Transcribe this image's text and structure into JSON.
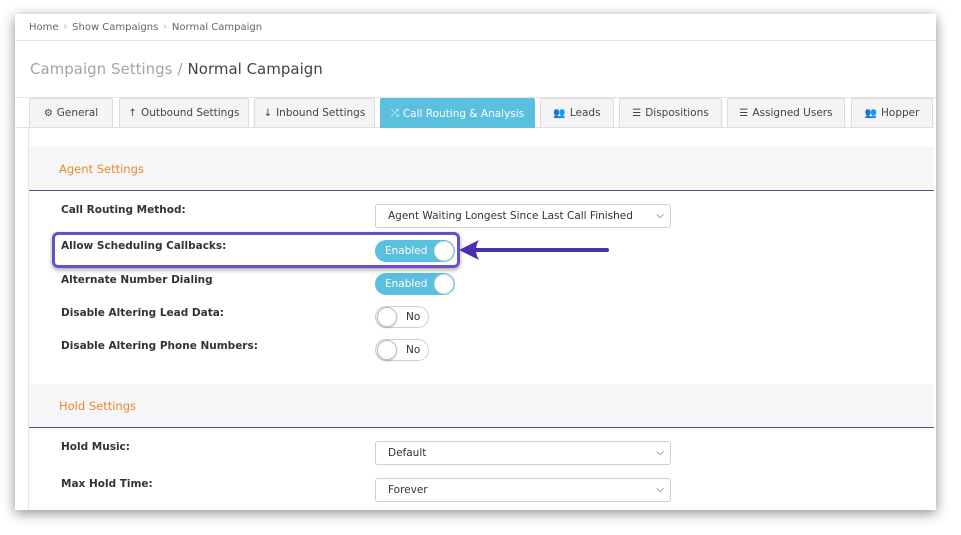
{
  "breadcrumb": {
    "items": [
      "Home",
      "Show Campaigns",
      "Normal Campaign"
    ],
    "separator": "›"
  },
  "header": {
    "title_muted": "Campaign Settings",
    "title_sep": "/",
    "title_main": "Normal Campaign"
  },
  "tabs": [
    {
      "label": "General",
      "icon": "⚙"
    },
    {
      "label": "Outbound Settings",
      "icon": "↑"
    },
    {
      "label": "Inbound Settings",
      "icon": "↓"
    },
    {
      "label": "Call Routing & Analysis",
      "icon": "⤮",
      "active": true
    },
    {
      "label": "Leads",
      "icon": "👥"
    },
    {
      "label": "Dispositions",
      "icon": "☰"
    },
    {
      "label": "Assigned Users",
      "icon": "☰"
    },
    {
      "label": "Hopper",
      "icon": "👥"
    }
  ],
  "agent_settings": {
    "heading": "Agent Settings",
    "call_routing_method": {
      "label": "Call Routing Method:",
      "value": "Agent Waiting Longest Since Last Call Finished"
    },
    "allow_scheduling_callbacks": {
      "label": "Allow Scheduling Callbacks:",
      "value": "Enabled"
    },
    "alternate_number_dialing": {
      "label": "Alternate Number Dialing",
      "value": "Enabled"
    },
    "disable_altering_lead_data": {
      "label": "Disable Altering Lead Data:",
      "value": "No"
    },
    "disable_altering_phone_numbers": {
      "label": "Disable Altering Phone Numbers:",
      "value": "No"
    }
  },
  "hold_settings": {
    "heading": "Hold Settings",
    "hold_music": {
      "label": "Hold Music:",
      "value": "Default"
    },
    "max_hold_time": {
      "label": "Max Hold Time:",
      "value": "Forever"
    }
  },
  "colors": {
    "accent": "#5bc0de",
    "heading": "#e48a2d",
    "annotation": "#6a4fc8"
  }
}
